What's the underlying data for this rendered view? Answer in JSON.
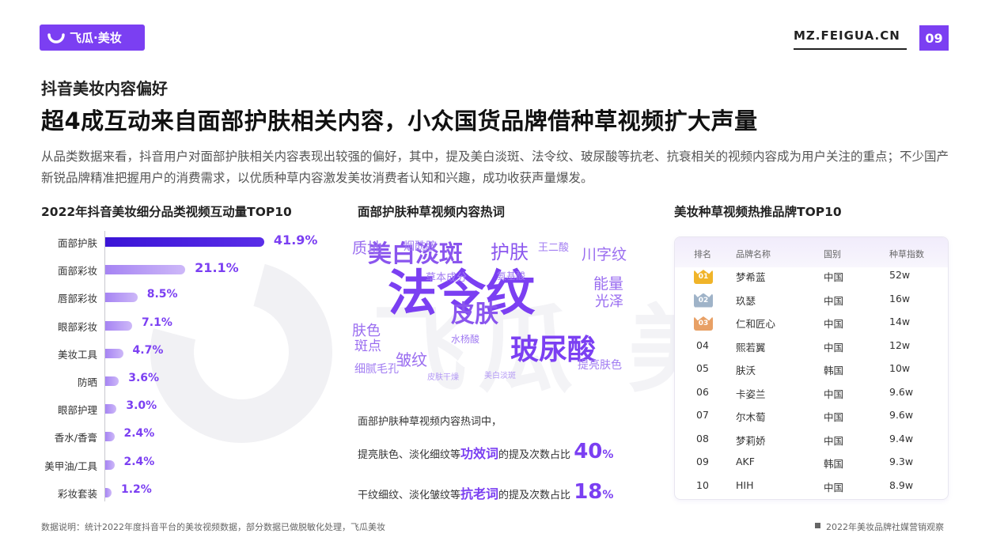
{
  "header": {
    "logo_text": "飞瓜·美妆",
    "site_url": "MZ.FEIGUA.CN",
    "page_number": "09",
    "accent_color": "#7b3ff2"
  },
  "kicker": "抖音美妆内容偏好",
  "headline": "超4成互动来自面部护肤相关内容，小众国货品牌借种草视频扩大声量",
  "description": "从品类数据来看，抖音用户对面部护肤相关内容表现出较强的偏好，其中，提及美白淡斑、法令纹、玻尿酸等抗老、抗衰相关的视频内容成为用户关注的重点；不少国产新锐品牌精准把握用户的消费需求，以优质种草内容激发美妆消费者认知和兴趣，成功收获声量爆发。",
  "bar_section": {
    "title": "2022年抖音美妆细分品类视频互动量TOP10"
  },
  "cloud_section": {
    "title": "面部护肤种草视频内容热词"
  },
  "brand_section": {
    "title": "美妆种草视频热推品牌TOP10"
  },
  "chart_data": {
    "type": "bar",
    "orientation": "horizontal",
    "title": "2022年抖音美妆细分品类视频互动量TOP10",
    "categories": [
      "面部护肤",
      "面部彩妆",
      "唇部彩妆",
      "眼部彩妆",
      "美妆工具",
      "防晒",
      "眼部护理",
      "香水/香膏",
      "美甲油/工具",
      "彩妆套装"
    ],
    "values": [
      41.9,
      21.1,
      8.5,
      7.1,
      4.7,
      3.6,
      3.0,
      2.4,
      2.4,
      1.2
    ],
    "labels": [
      "41.9%",
      "21.1%",
      "8.5%",
      "7.1%",
      "4.7%",
      "3.6%",
      "3.0%",
      "2.4%",
      "2.4%",
      "1.2%"
    ],
    "unit": "%",
    "xlim": [
      0,
      45
    ],
    "grid": false,
    "colors": {
      "top": "#3a14d6",
      "rest": "#b89af5"
    }
  },
  "word_cloud": [
    {
      "text": "法令纹",
      "size": 62,
      "color": "#7b3ff2"
    },
    {
      "text": "玻尿酸",
      "size": 36,
      "color": "#7b3ff2"
    },
    {
      "text": "美白淡斑",
      "size": 30,
      "color": "#8a55ee"
    },
    {
      "text": "皮肤",
      "size": 30,
      "color": "#8a55ee"
    },
    {
      "text": "护肤",
      "size": 24,
      "color": "#8a55ee"
    },
    {
      "text": "皱纹",
      "size": 20,
      "color": "#9a6df0"
    },
    {
      "text": "川字纹",
      "size": 19,
      "color": "#9a6df0"
    },
    {
      "text": "能量",
      "size": 19,
      "color": "#9a6df0"
    },
    {
      "text": "光泽",
      "size": 18,
      "color": "#9a6df0"
    },
    {
      "text": "质地",
      "size": 19,
      "color": "#9a6df0"
    },
    {
      "text": "肤色",
      "size": 18,
      "color": "#9a6df0"
    },
    {
      "text": "斑点",
      "size": 17,
      "color": "#9a6df0"
    },
    {
      "text": "提亮肤色",
      "size": 14,
      "color": "#a27df2"
    },
    {
      "text": "细腻毛孔",
      "size": 14,
      "color": "#a27df2"
    },
    {
      "text": "烟酰胺",
      "size": 14,
      "color": "#a27df2"
    },
    {
      "text": "草本成分",
      "size": 13,
      "color": "#a27df2"
    },
    {
      "text": "王二酸",
      "size": 13,
      "color": "#a27df2"
    },
    {
      "text": "氨基酸",
      "size": 12,
      "color": "#a27df2"
    },
    {
      "text": "水杨酸",
      "size": 12,
      "color": "#a27df2"
    },
    {
      "text": "皮肤干燥",
      "size": 10,
      "color": "#b49af5"
    },
    {
      "text": "美白淡斑",
      "size": 10,
      "color": "#b49af5"
    }
  ],
  "insights": {
    "intro": "面部护肤种草视频内容热词中，",
    "line1": {
      "prefix": "提亮肤色、淡化细纹等",
      "keyword": "功效词",
      "middle": "的提及次数占比",
      "value": "40",
      "unit": "%"
    },
    "line2": {
      "prefix": "干纹细纹、淡化皱纹等",
      "keyword": "抗老词",
      "middle": "的提及次数占比",
      "value": "18",
      "unit": "%"
    }
  },
  "brand_table": {
    "headers": [
      "排名",
      "品牌名称",
      "国别",
      "种草指数"
    ],
    "rows": [
      {
        "rank": "01",
        "brand": "梦希蓝",
        "country": "中国",
        "index": "52w"
      },
      {
        "rank": "02",
        "brand": "玖瑟",
        "country": "中国",
        "index": "16w"
      },
      {
        "rank": "03",
        "brand": "仁和匠心",
        "country": "中国",
        "index": "14w"
      },
      {
        "rank": "04",
        "brand": "熙若翼",
        "country": "中国",
        "index": "12w"
      },
      {
        "rank": "05",
        "brand": "肤沃",
        "country": "韩国",
        "index": "10w"
      },
      {
        "rank": "06",
        "brand": "卡姿兰",
        "country": "中国",
        "index": "9.6w"
      },
      {
        "rank": "07",
        "brand": "尔木萄",
        "country": "中国",
        "index": "9.6w"
      },
      {
        "rank": "08",
        "brand": "梦莉娇",
        "country": "中国",
        "index": "9.4w"
      },
      {
        "rank": "09",
        "brand": "AKF",
        "country": "韩国",
        "index": "9.3w"
      },
      {
        "rank": "10",
        "brand": "HIH",
        "country": "中国",
        "index": "8.9w"
      }
    ],
    "medal_colors": [
      "#f0b429",
      "#9fb3c8",
      "#e8a065"
    ]
  },
  "footer": {
    "note": "数据说明：统计2022年度抖音平台的美妆视频数据，部分数据已做脱敏化处理，飞瓜美妆",
    "report": "2022年美妆品牌社媒营销观察"
  }
}
